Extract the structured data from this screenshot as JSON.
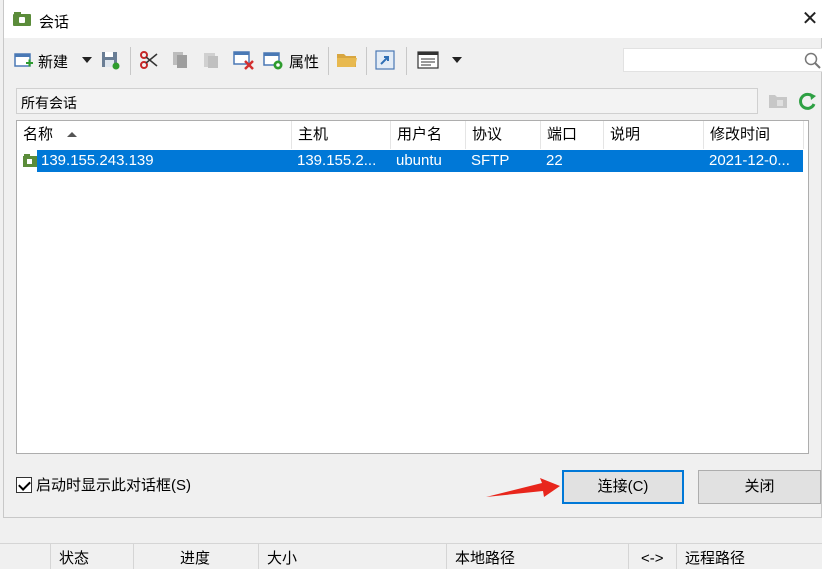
{
  "window": {
    "title": "会话",
    "close": "✕"
  },
  "toolbar": {
    "new_label": "新建",
    "properties_label": "属性"
  },
  "path": {
    "label": "所有会话"
  },
  "columns": [
    "名称",
    "主机",
    "用户名",
    "协议",
    "端口",
    "说明",
    "修改时间"
  ],
  "sessions": [
    {
      "name": "139.155.243.139",
      "host": "139.155.2...",
      "user": "ubuntu",
      "protocol": "SFTP",
      "port": "22",
      "description": "",
      "modified": "2021-12-0..."
    }
  ],
  "startup": {
    "label": "启动时显示此对话框(S)",
    "checked": true
  },
  "buttons": {
    "connect": "连接(C)",
    "close": "关闭"
  },
  "statusbar": {
    "status": "状态",
    "progress": "进度",
    "size": "大小",
    "local_path": "本地路径",
    "direction": "<->",
    "remote_path": "远程路径"
  },
  "colors": {
    "accent": "#0078d7",
    "annotation_arrow": "#e8261c",
    "refresh": "#2ea043"
  }
}
